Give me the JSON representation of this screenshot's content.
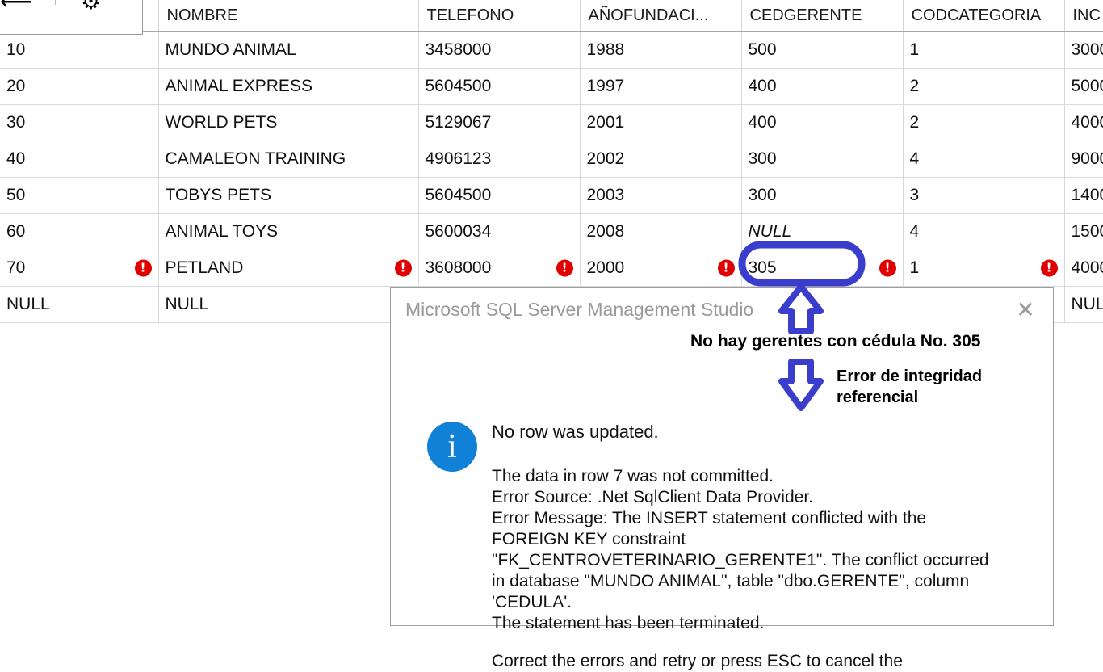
{
  "toolbar": {
    "back_icon": "left-arrow-icon",
    "gear_icon": "gear-icon"
  },
  "grid": {
    "columns": [
      {
        "key": "codigo",
        "label": ""
      },
      {
        "key": "nombre",
        "label": "NOMBRE"
      },
      {
        "key": "telefono",
        "label": "TELEFONO"
      },
      {
        "key": "aniofundacion",
        "label": "AÑOFUNDACI..."
      },
      {
        "key": "cedgerente",
        "label": "CEDGERENTE"
      },
      {
        "key": "codcategoria",
        "label": "CODCATEGORIA"
      },
      {
        "key": "ingresos",
        "label": "INC"
      }
    ],
    "rows": [
      {
        "codigo": "10",
        "nombre": "MUNDO ANIMAL",
        "telefono": "3458000",
        "aniofundacion": "1988",
        "cedgerente": "500",
        "codcategoria": "1",
        "ingresos": "3000",
        "error": false,
        "null_cells": []
      },
      {
        "codigo": "20",
        "nombre": "ANIMAL EXPRESS",
        "telefono": "5604500",
        "aniofundacion": "1997",
        "cedgerente": "400",
        "codcategoria": "2",
        "ingresos": "5000",
        "error": false,
        "null_cells": []
      },
      {
        "codigo": "30",
        "nombre": "WORLD PETS",
        "telefono": "5129067",
        "aniofundacion": "2001",
        "cedgerente": "400",
        "codcategoria": "2",
        "ingresos": "4000",
        "error": false,
        "null_cells": []
      },
      {
        "codigo": "40",
        "nombre": "CAMALEON TRAINING",
        "telefono": "4906123",
        "aniofundacion": "2002",
        "cedgerente": "300",
        "codcategoria": "4",
        "ingresos": "9000",
        "error": false,
        "null_cells": []
      },
      {
        "codigo": "50",
        "nombre": "TOBYS PETS",
        "telefono": "5604500",
        "aniofundacion": "2003",
        "cedgerente": "300",
        "codcategoria": "3",
        "ingresos": "1400",
        "error": false,
        "null_cells": []
      },
      {
        "codigo": "60",
        "nombre": "ANIMAL TOYS",
        "telefono": "5600034",
        "aniofundacion": "2008",
        "cedgerente": "NULL",
        "codcategoria": "4",
        "ingresos": "1500",
        "error": false,
        "null_cells": [
          "cedgerente"
        ]
      },
      {
        "codigo": "70",
        "nombre": "PETLAND",
        "telefono": "3608000",
        "aniofundacion": "2000",
        "cedgerente": "305",
        "codcategoria": "1",
        "ingresos": "4000",
        "error": true,
        "null_cells": []
      },
      {
        "codigo": "NULL",
        "nombre": "NULL",
        "telefono": "",
        "aniofundacion": "",
        "cedgerente": "",
        "codcategoria": "",
        "ingresos": "NULL",
        "error": false,
        "null_cells": []
      }
    ],
    "error_badge_glyph": "!",
    "highlighted_cell": {
      "row": 7,
      "column": "cedgerente",
      "value": "305"
    }
  },
  "dialog": {
    "title": "Microsoft SQL Server Management Studio",
    "close_label": "✕",
    "icon": "info-icon",
    "icon_glyph": "i",
    "headline": "No row was updated.",
    "detail": "The data in row 7 was not committed.\nError Source: .Net SqlClient Data Provider.\nError Message: The INSERT statement conflicted with the\nFOREIGN KEY constraint\n\"FK_CENTROVETERINARIO_GERENTE1\". The conflict occurred\nin database \"MUNDO ANIMAL\", table \"dbo.GERENTE\", column\n'CEDULA'.\nThe statement has been terminated.",
    "footer_note": "Correct the errors and retry or press ESC to cancel the"
  },
  "annotations": {
    "accent_color": "#3b3ecc",
    "note_1": "No hay gerentes con cédula No. 305",
    "note_2": "Error de integridad referencial",
    "highlight_shape": "rounded-rect-ellipse",
    "arrow_up": "arrow-up-icon",
    "arrow_down": "arrow-down-icon"
  }
}
